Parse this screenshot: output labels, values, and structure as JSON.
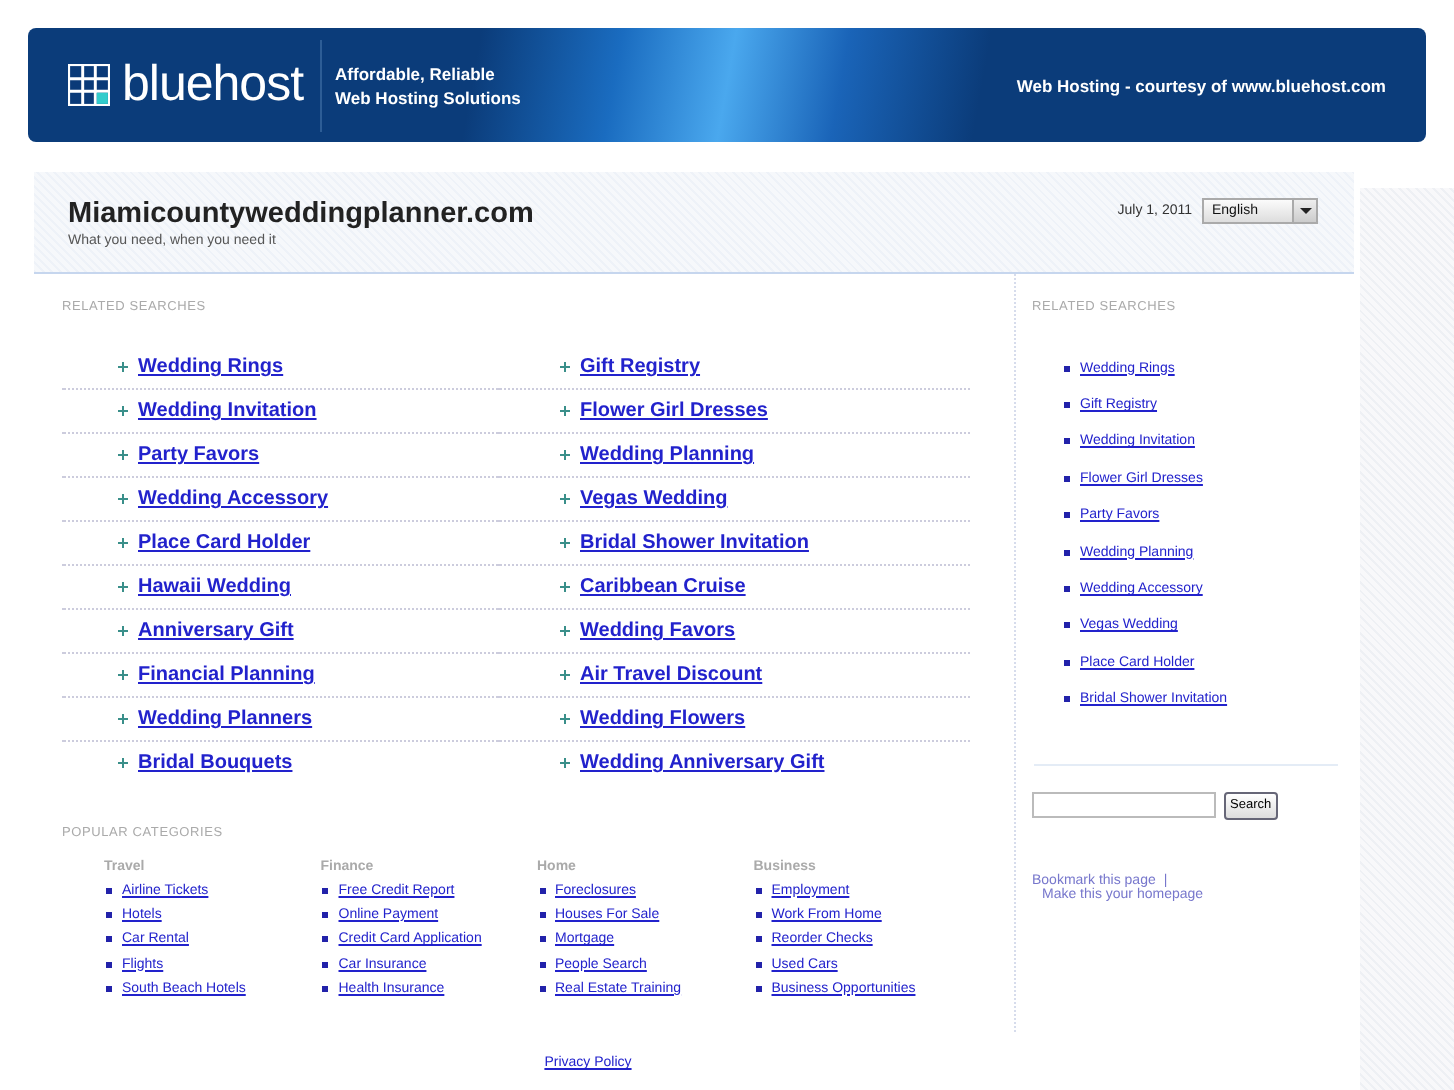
{
  "banner": {
    "logo": "bluehost",
    "tagline_1": "Affordable, Reliable",
    "tagline_2": "Web Hosting Solutions",
    "courtesy": "Web Hosting - courtesy of www.bluehost.com"
  },
  "header": {
    "site_title": "Miamicountyweddingplanner.com",
    "subtitle": "What you need, when you need it",
    "date": "July 1, 2011",
    "language": "English"
  },
  "related_searches": {
    "heading": "RELATED SEARCHES",
    "links": [
      {
        "label": "Wedding Rings"
      },
      {
        "label": "Gift Registry"
      },
      {
        "label": "Wedding Invitation"
      },
      {
        "label": "Flower Girl Dresses"
      },
      {
        "label": "Party Favors"
      },
      {
        "label": "Wedding Planning"
      },
      {
        "label": "Wedding Accessory"
      },
      {
        "label": "Vegas Wedding"
      },
      {
        "label": "Place Card Holder"
      },
      {
        "label": "Bridal Shower Invitation"
      },
      {
        "label": "Hawaii Wedding"
      },
      {
        "label": "Caribbean Cruise"
      },
      {
        "label": "Anniversary Gift"
      },
      {
        "label": "Wedding Favors"
      },
      {
        "label": "Financial Planning"
      },
      {
        "label": "Air Travel Discount"
      },
      {
        "label": "Wedding Planners"
      },
      {
        "label": "Wedding Flowers"
      },
      {
        "label": "Bridal Bouquets"
      },
      {
        "label": "Wedding Anniversary Gift"
      }
    ]
  },
  "popular_categories": {
    "heading": "POPULAR CATEGORIES",
    "columns": [
      {
        "title": "Travel",
        "links": [
          "Airline Tickets",
          "Hotels",
          "Car Rental",
          "Flights",
          "South Beach Hotels"
        ]
      },
      {
        "title": "Finance",
        "links": [
          "Free Credit Report",
          "Online Payment",
          "Credit Card Application",
          "Car Insurance",
          "Health Insurance"
        ]
      },
      {
        "title": "Home",
        "links": [
          "Foreclosures",
          "Houses For Sale",
          "Mortgage",
          "People Search",
          "Real Estate Training"
        ]
      },
      {
        "title": "Business",
        "links": [
          "Employment",
          "Work From Home",
          "Reorder Checks",
          "Used Cars",
          "Business Opportunities"
        ]
      }
    ]
  },
  "footer": {
    "privacy": "Privacy Policy"
  },
  "sidebar": {
    "heading": "RELATED SEARCHES",
    "links": [
      "Wedding Rings",
      "Gift Registry",
      "Wedding Invitation",
      "Flower Girl Dresses",
      "Party Favors",
      "Wedding Planning",
      "Wedding Accessory",
      "Vegas Wedding",
      "Place Card Holder",
      "Bridal Shower Invitation"
    ],
    "search_button": "Search",
    "bookmark": "Bookmark this page",
    "separator": "|",
    "homepage": "Make this your homepage"
  }
}
